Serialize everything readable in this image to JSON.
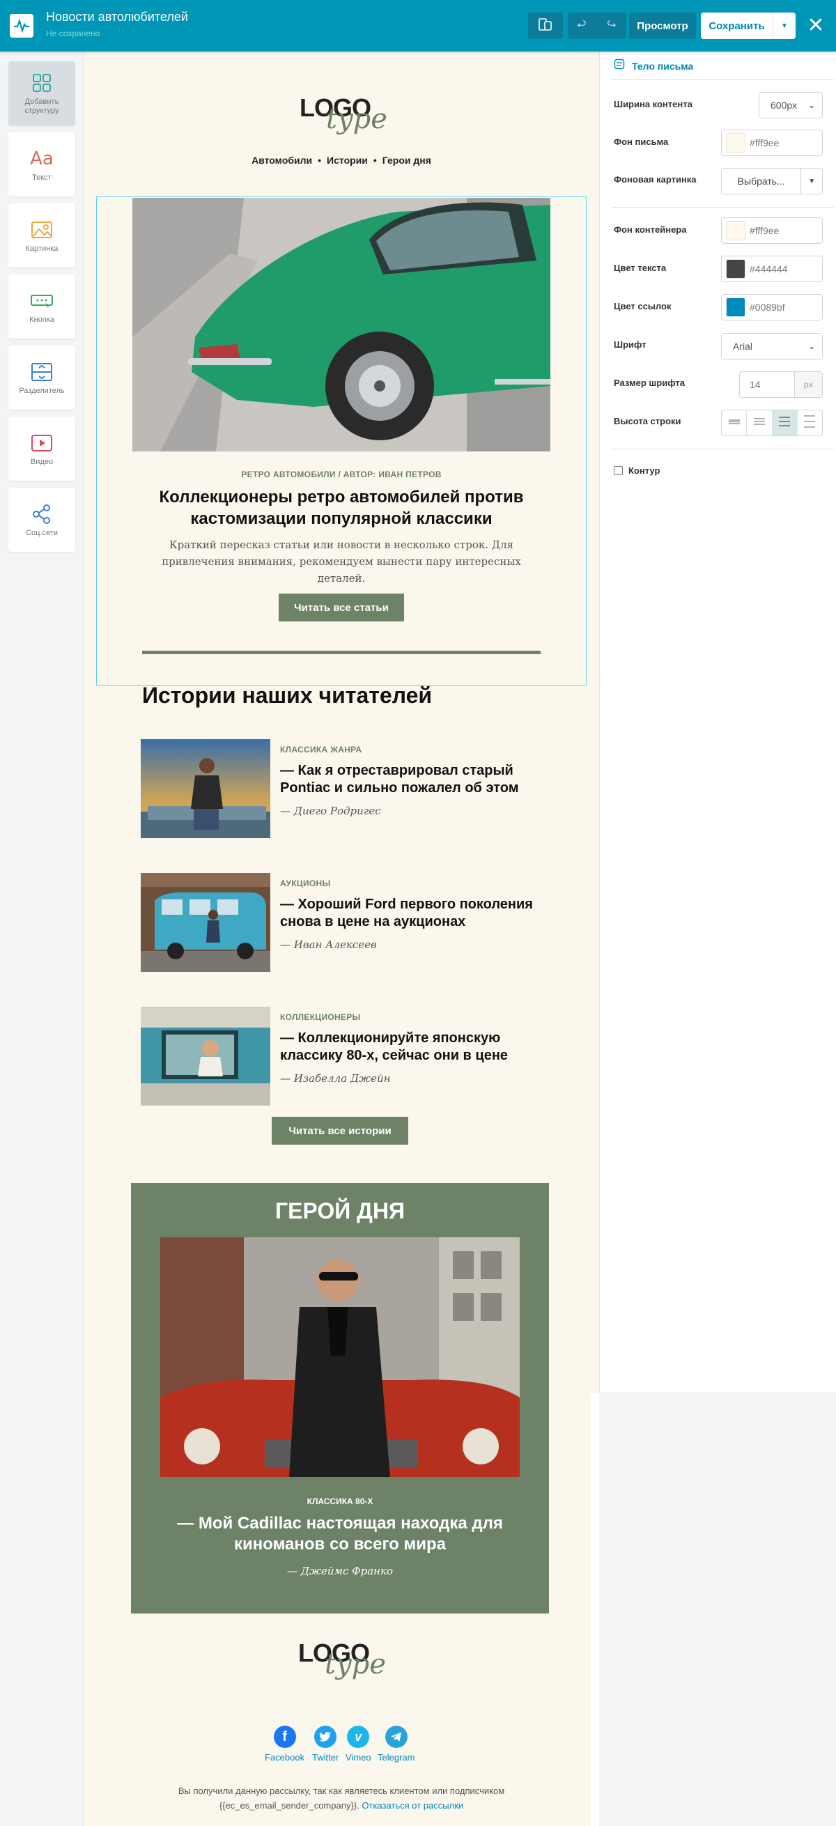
{
  "topbar": {
    "title": "Новости автолюбителей",
    "status": "Не сохранено",
    "preview_label": "Просмотр",
    "save_label": "Сохранить"
  },
  "tools": [
    {
      "label": "Добавить структуру",
      "icon": "grid-icon"
    },
    {
      "label": "Текст",
      "icon": "text-icon"
    },
    {
      "label": "Картинка",
      "icon": "image-icon"
    },
    {
      "label": "Кнопка",
      "icon": "button-icon"
    },
    {
      "label": "Разделитель",
      "icon": "divider-icon"
    },
    {
      "label": "Видео",
      "icon": "video-icon"
    },
    {
      "label": "Соц.сети",
      "icon": "share-icon"
    }
  ],
  "email": {
    "logo_main": "LOGO",
    "logo_script": "type",
    "nav": [
      "Автомобили",
      "Истории",
      "Герои дня"
    ],
    "nav_separator": "•",
    "hero": {
      "kicker": "РЕТРО АВТОМОБИЛИ / АВТОР: ИВАН ПЕТРОВ",
      "title": "Коллекционеры ретро автомобилей против кастомизации популярной классики",
      "desc": "Краткий пересказ статьи или новости в несколько строк. Для привлечения внимания, рекомендуем вынести пару интересных деталей.",
      "button": "Читать все статьи"
    },
    "stories_title": "Истории наших читателей",
    "stories": [
      {
        "kicker": "КЛАССИКА ЖАНРА",
        "title": "— Как я отреставрировал старый Pontiac и сильно пожалел об этом",
        "author": "— Диего Родригес"
      },
      {
        "kicker": "АУКЦИОНЫ",
        "title": "— Хороший Ford первого поколения снова в цене на аукционах",
        "author": "— Иван Алексеев"
      },
      {
        "kicker": "КОЛЛЕКЦИОНЕРЫ",
        "title": "— Коллекционируйте японскую классику 80-х, сейчас они в цене",
        "author": "— Изабелла Джейн"
      }
    ],
    "stories_button": "Читать все истории",
    "hero_day": {
      "title": "ГЕРОЙ ДНЯ",
      "kicker": "КЛАССИКА 80-Х",
      "caption": "— Мой Cadillac настоящая находка для киноманов со всего мира",
      "author": "— Джеймс Франко"
    },
    "social": [
      {
        "label": "Facebook",
        "color": "#1877f2"
      },
      {
        "label": "Twitter",
        "color": "#1da1f2"
      },
      {
        "label": "Vimeo",
        "color": "#1ab7ea"
      },
      {
        "label": "Telegram",
        "color": "#2aa3d9"
      }
    ],
    "footer_text": "Вы получили данную рассылку, так как являетесь клиентом или подписчиком {{ec_es_email_sender_company}}.",
    "footer_link": "Отказаться от рассылки"
  },
  "panel": {
    "header": "Тело письма",
    "content_width_label": "Ширина контента",
    "content_width_value": "600px",
    "bg_label": "Фон письма",
    "bg_value": "#fff9ee",
    "bg_image_label": "Фоновая картинка",
    "bg_image_button": "Выбрать...",
    "container_bg_label": "Фон контейнера",
    "container_bg_value": "#fff9ee",
    "text_color_label": "Цвет текста",
    "text_color_value": "#444444",
    "link_color_label": "Цвет ссылок",
    "link_color_value": "#0089bf",
    "font_label": "Шрифт",
    "font_value": "Arial",
    "font_size_label": "Размер шрифта",
    "font_size_value": "14",
    "font_size_unit": "px",
    "line_height_label": "Высота строки",
    "outline_label": "Контур"
  },
  "colors": {
    "brand": "#0096b8",
    "accent_green": "#6e8268",
    "canvas_bg": "#fcf7ec"
  }
}
